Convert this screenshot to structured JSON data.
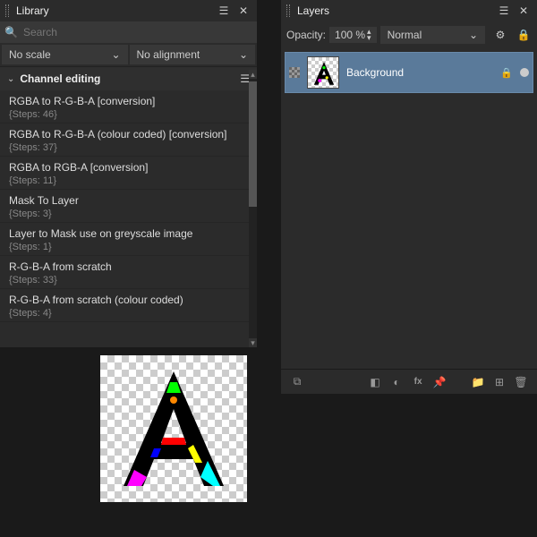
{
  "library": {
    "tab_label": "Library",
    "search_placeholder": "Search",
    "scale_label": "No scale",
    "align_label": "No alignment",
    "section_title": "Channel editing",
    "items": [
      {
        "name": "RGBA to R-G-B-A [conversion]",
        "steps": "{Steps: 46}"
      },
      {
        "name": "RGBA to R-G-B-A (colour coded) [conversion]",
        "steps": "{Steps: 37}"
      },
      {
        "name": "RGBA to RGB-A [conversion]",
        "steps": "{Steps: 11}"
      },
      {
        "name": "Mask To Layer",
        "steps": "{Steps: 3}"
      },
      {
        "name": "Layer to Mask use on greyscale image",
        "steps": "{Steps: 1}"
      },
      {
        "name": "R-G-B-A from scratch",
        "steps": "{Steps: 33}"
      },
      {
        "name": "R-G-B-A from scratch (colour coded)",
        "steps": "{Steps: 4}"
      }
    ]
  },
  "layers": {
    "tab_label": "Layers",
    "opacity_label": "Opacity:",
    "opacity_value": "100 %",
    "blend_mode": "Normal",
    "layer_name": "Background"
  }
}
